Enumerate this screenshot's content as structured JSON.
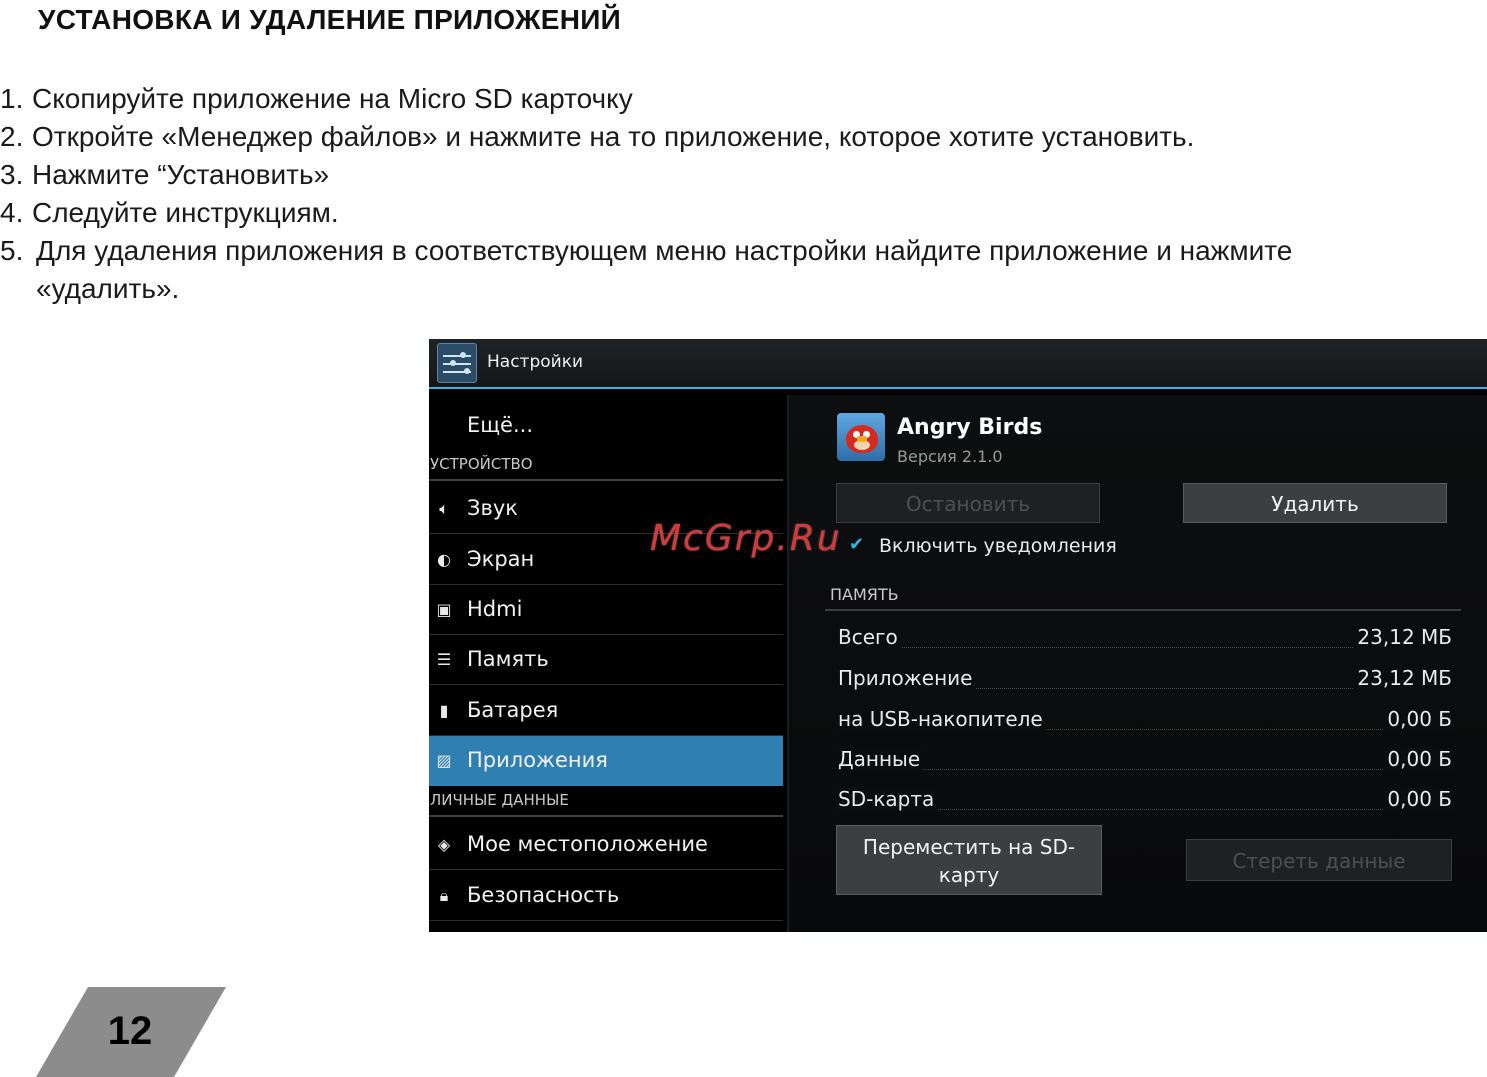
{
  "heading": "УСТАНОВКА И УДАЛЕНИЕ ПРИЛОЖЕНИЙ",
  "steps": [
    {
      "num": "1.",
      "text": "Скопируйте приложение на Micro SD карточку"
    },
    {
      "num": "2.",
      "text": "Откройте «Менеджер файлов» и нажмите на то приложение, которое хотите установить."
    },
    {
      "num": "3.",
      "text": "Нажмите “Установить»"
    },
    {
      "num": "4.",
      "text": "Следуйте инструкциям."
    },
    {
      "num": "5.",
      "text": "Для удаления приложения в соответствующем меню настройки найдите приложение и нажмите",
      "cont": "«удалить»."
    }
  ],
  "screen": {
    "title": "Настройки",
    "sidebar": {
      "more": "Ещё...",
      "section_device": "УСТРОЙСТВО",
      "items": [
        {
          "label": "Звук",
          "icon": "speaker-icon"
        },
        {
          "label": "Экран",
          "icon": "brightness-icon"
        },
        {
          "label": "Hdmi",
          "icon": "monitor-icon"
        },
        {
          "label": "Память",
          "icon": "storage-icon"
        },
        {
          "label": "Батарея",
          "icon": "battery-icon"
        },
        {
          "label": "Приложения",
          "icon": "apps-icon",
          "active": true
        }
      ],
      "section_personal": "ЛИЧНЫЕ ДАННЫЕ",
      "personal_items": [
        {
          "label": "Мое местоположение",
          "icon": "location-icon"
        },
        {
          "label": "Безопасность",
          "icon": "lock-icon"
        }
      ]
    },
    "detail": {
      "app_name": "Angry Birds",
      "version": "Версия 2.1.0",
      "stop_label": "Остановить",
      "delete_label": "Удалить",
      "notify_label": "Включить уведомления",
      "memory_heading": "ПАМЯТЬ",
      "memory": [
        {
          "key": "Всего",
          "value": "23,12 МБ"
        },
        {
          "key": "Приложение",
          "value": "23,12 МБ"
        },
        {
          "key": "на USB-накопителе",
          "value": "0,00 Б"
        },
        {
          "key": "Данные",
          "value": "0,00 Б"
        },
        {
          "key": "SD-карта",
          "value": "0,00 Б"
        }
      ],
      "move_label": "Переместить на SD-карту",
      "clear_label": "Стереть данные"
    }
  },
  "watermark": "McGrp.Ru",
  "page_number": "12",
  "colors": {
    "accent": "#33b5e5",
    "active_item": "#2f7fb0",
    "page_tab": "#8c8c8c",
    "watermark": "#d43a3a"
  }
}
